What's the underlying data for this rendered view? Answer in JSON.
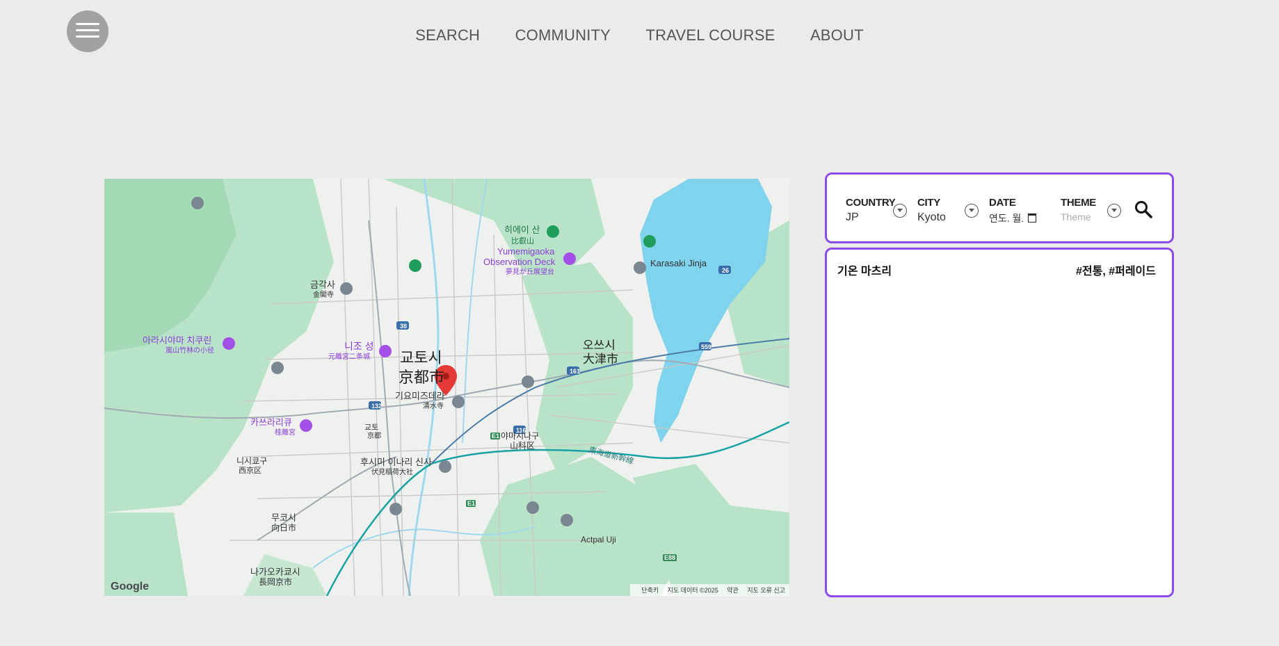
{
  "nav": {
    "items": [
      "SEARCH",
      "COMMUNITY",
      "TRAVEL COURSE",
      "ABOUT"
    ]
  },
  "menu": {
    "icon": "hamburger-icon"
  },
  "map": {
    "labels": {
      "city_ko": "교토시",
      "city_ja": "京都市",
      "otsu_ko": "오쓰시",
      "otsu_ja": "大津市",
      "hieizan": "히에이 산",
      "hieizan_ja": "比叡山",
      "yumemigaoka": "Yumemigaoka",
      "observation": "Observation Deck",
      "observation_ja": "夢見が丘展望台",
      "arashiyama": "아라시야마 치쿠린",
      "arashiyama_ja": "嵐山竹林の小径",
      "nijo": "니조 성",
      "nijo_ja": "元離宮二条城",
      "kiyomizu": "기요미즈데라",
      "kiyomizu_ja": "清水寺",
      "fushimi": "후시미 이나리 신사",
      "fushimi_ja": "伏見稲荷大社",
      "kinkaku": "금각사",
      "kinkaku_ja": "金閣寺",
      "katsura": "카쓰라리큐",
      "katsura_ja": "桂離宮",
      "karasaki": "Karasaki Jinja",
      "muko": "무코시",
      "muko_ja": "向日市",
      "nagaokakyo": "나가오카쿄시",
      "nagaokakyo_ja": "長岡京市",
      "yamashina": "야마시나구",
      "yamashina_ja": "山科区",
      "nishikyo": "니시쿄구",
      "nishikyo_ja": "西京区",
      "uji": "Actpal Uji",
      "lake_shinkansen": "東海道新幹線",
      "kyoto_station": "교토",
      "kyoto_station_ja": "京都"
    },
    "google": "Google",
    "attribution": [
      "단축키",
      "지도 데이터 ©2025",
      "약관",
      "지도 오류 신고"
    ]
  },
  "search": {
    "country": {
      "label": "COUNTRY",
      "value": "JP"
    },
    "city": {
      "label": "CITY",
      "value": "Kyoto"
    },
    "date": {
      "label": "DATE",
      "value": "연도. 월."
    },
    "theme": {
      "label": "THEME",
      "placeholder": "Theme"
    }
  },
  "result": {
    "title": "기온 마츠리",
    "tags": "#전통, #퍼레이드"
  },
  "colors": {
    "accent": "#8a4be8",
    "background": "#ebebeb",
    "water": "#7fd3ec",
    "park": "#b8e2c7",
    "pin": "#e53935"
  }
}
